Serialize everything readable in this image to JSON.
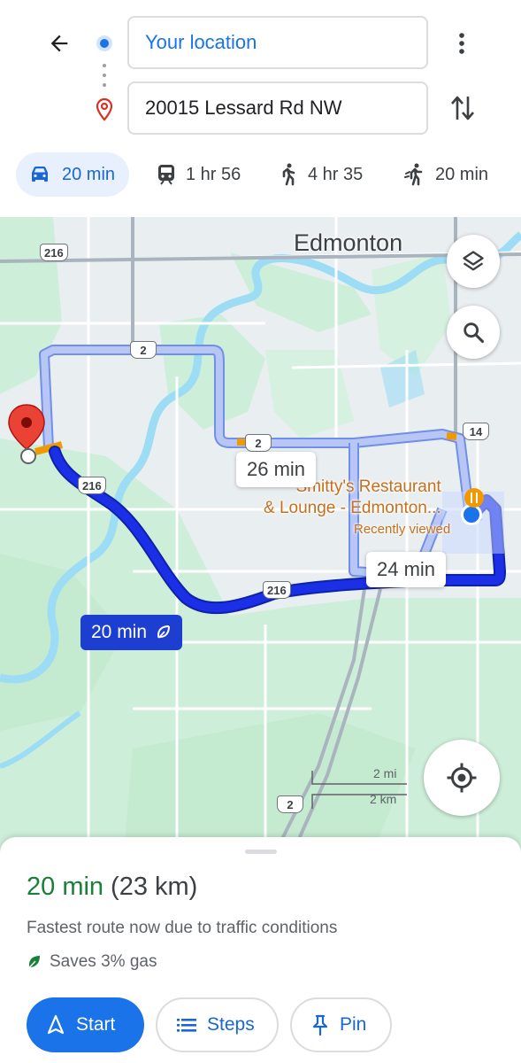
{
  "directions": {
    "origin_value": "Your location",
    "destination_value": "20015 Lessard Rd NW"
  },
  "travel_modes": [
    {
      "mode": "drive",
      "icon": "car-icon",
      "label": "20 min",
      "selected": true
    },
    {
      "mode": "transit",
      "icon": "train-icon",
      "label": "1 hr 56",
      "selected": false
    },
    {
      "mode": "walk",
      "icon": "walk-icon",
      "label": "4 hr 35",
      "selected": false
    },
    {
      "mode": "ride",
      "icon": "ride-icon",
      "label": "20 min",
      "selected": false
    }
  ],
  "map": {
    "city_label": "Edmonton",
    "poi": {
      "name_line1": "Smitty's Restaurant",
      "name_line2": "& Lounge - Edmonton...",
      "subtitle": "Recently viewed"
    },
    "route_times": {
      "alt_1": "26 min",
      "alt_2": "24 min",
      "selected": "20 min"
    },
    "road_shields": [
      "216",
      "2",
      "2",
      "14",
      "216",
      "216",
      "2"
    ],
    "scale": {
      "miles": "2 mi",
      "km": "2 km"
    },
    "colors": {
      "selected_route": "#1a2fe6",
      "alt_route": "#a8b8f0",
      "park": "#c8ecd4",
      "water": "#9cdcf5",
      "land": "#e9eef0"
    }
  },
  "summary": {
    "duration": "20 min",
    "distance": "(23 km)",
    "note": "Fastest route now due to traffic conditions",
    "eco_text": "Saves 3% gas"
  },
  "actions": {
    "start_label": "Start",
    "steps_label": "Steps",
    "pin_label": "Pin"
  },
  "colors": {
    "accent": "#1a73e8",
    "eco_green": "#188038"
  }
}
